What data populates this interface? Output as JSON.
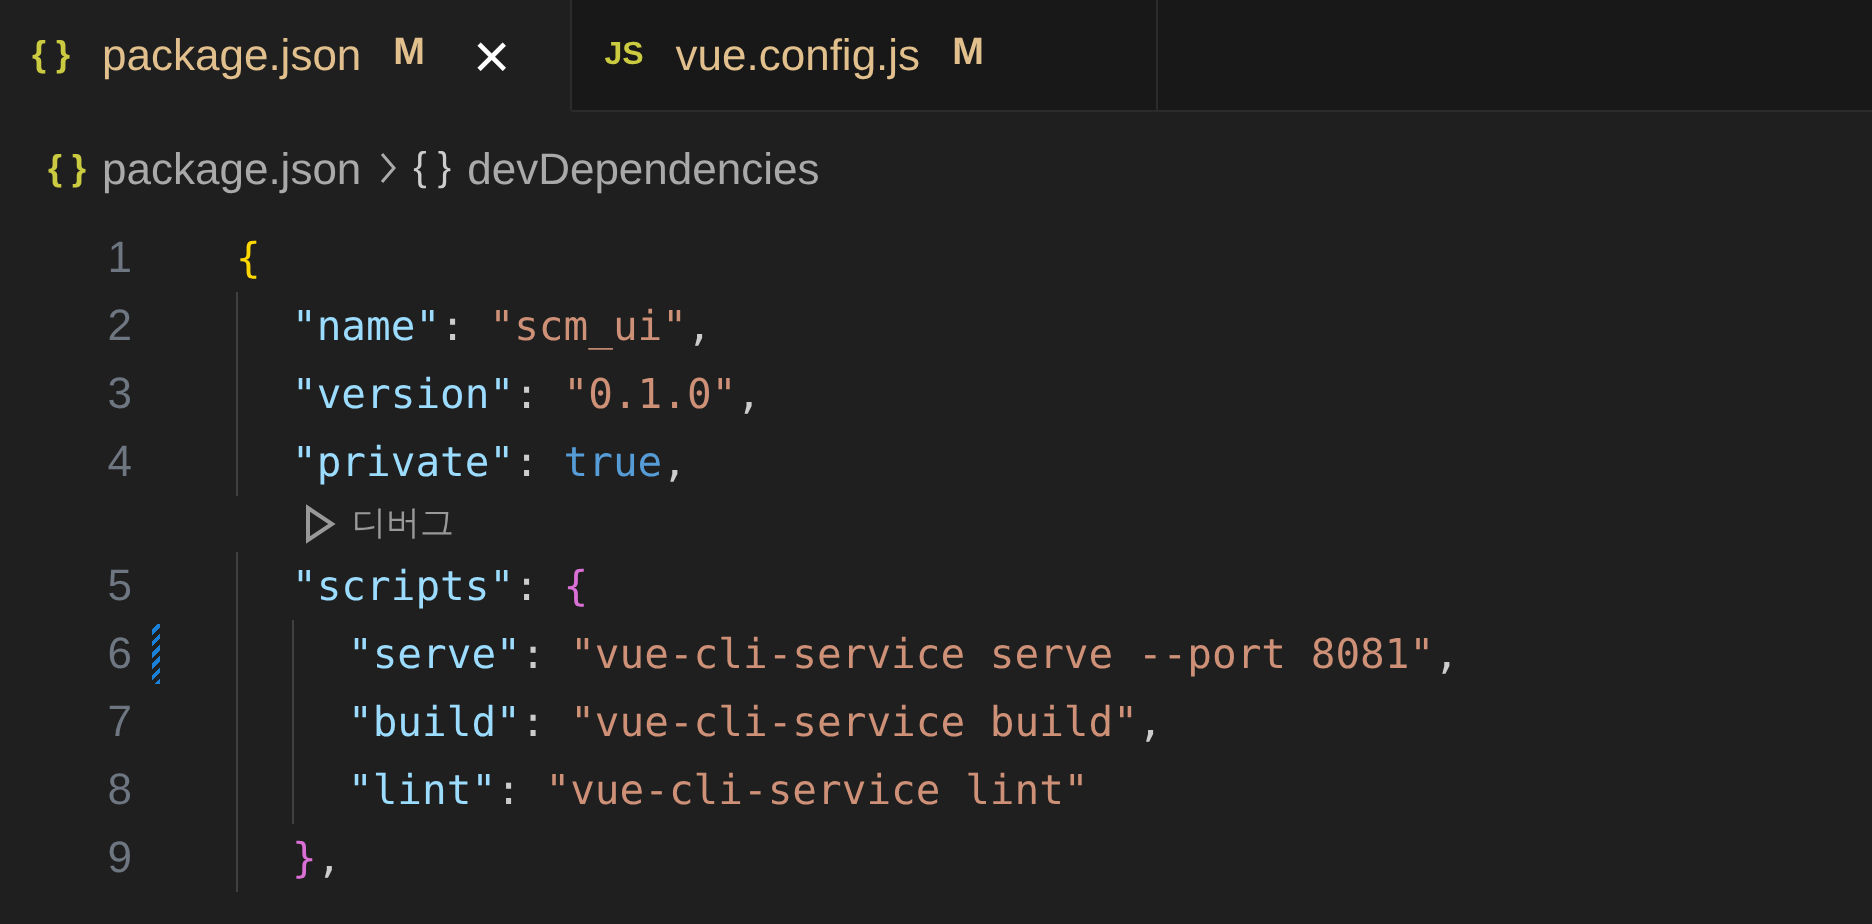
{
  "tabs": [
    {
      "icon": "{ }",
      "label": "package.json",
      "status": "M",
      "selected": true,
      "close": "×"
    },
    {
      "icon": "JS",
      "label": "vue.config.js",
      "status": "M",
      "selected": false
    }
  ],
  "breadcrumb": [
    {
      "icon": "{ }",
      "label": "package.json"
    },
    {
      "icon": "{ }",
      "label": "devDependencies"
    }
  ],
  "lines": [
    {
      "number": "1",
      "modified": false,
      "tokens": [
        {
          "text": "{",
          "kind": "brace1"
        }
      ],
      "children": [
        {
          "number": "2",
          "modified": false,
          "tokens": [
            {
              "text": "\"name\"",
              "kind": "key"
            },
            {
              "text": ": ",
              "kind": "punct"
            },
            {
              "text": "\"scm_ui\"",
              "kind": "string"
            },
            {
              "text": ",",
              "kind": "punct"
            }
          ]
        },
        {
          "number": "3",
          "modified": false,
          "tokens": [
            {
              "text": "\"version\"",
              "kind": "key"
            },
            {
              "text": ": ",
              "kind": "punct"
            },
            {
              "text": "\"0.1.0\"",
              "kind": "string"
            },
            {
              "text": ",",
              "kind": "punct"
            }
          ]
        },
        {
          "number": "4",
          "modified": false,
          "tokens": [
            {
              "text": "\"private\"",
              "kind": "key"
            },
            {
              "text": ": ",
              "kind": "punct"
            },
            {
              "text": "true",
              "kind": "keyword"
            },
            {
              "text": ",",
              "kind": "punct"
            }
          ]
        },
        {
          "number": "5",
          "modified": false,
          "codelens": "디버그",
          "tokens": [
            {
              "text": "\"scripts\"",
              "kind": "key"
            },
            {
              "text": ": ",
              "kind": "punct"
            },
            {
              "text": "{",
              "kind": "brace2"
            }
          ],
          "children": [
            {
              "number": "6",
              "modified": true,
              "tokens": [
                {
                  "text": "\"serve\"",
                  "kind": "key"
                },
                {
                  "text": ": ",
                  "kind": "punct"
                },
                {
                  "text": "\"vue-cli-service serve --port 8081\"",
                  "kind": "string"
                },
                {
                  "text": ",",
                  "kind": "punct"
                }
              ]
            },
            {
              "number": "7",
              "modified": false,
              "tokens": [
                {
                  "text": "\"build\"",
                  "kind": "key"
                },
                {
                  "text": ": ",
                  "kind": "punct"
                },
                {
                  "text": "\"vue-cli-service build\"",
                  "kind": "string"
                },
                {
                  "text": ",",
                  "kind": "punct"
                }
              ]
            },
            {
              "number": "8",
              "modified": false,
              "tokens": [
                {
                  "text": "\"lint\"",
                  "kind": "key"
                },
                {
                  "text": ": ",
                  "kind": "punct"
                },
                {
                  "text": "\"vue-cli-service lint\"",
                  "kind": "string"
                }
              ]
            }
          ]
        },
        {
          "number": "9",
          "modified": false,
          "tokens": [
            {
              "text": "}",
              "kind": "brace2"
            },
            {
              "text": ",",
              "kind": "punct"
            }
          ]
        }
      ]
    }
  ]
}
